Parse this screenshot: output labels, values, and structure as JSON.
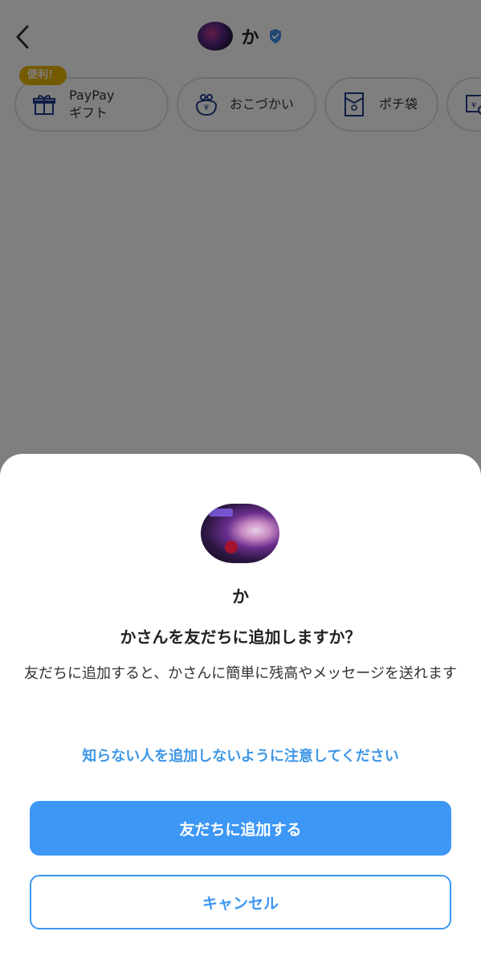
{
  "header": {
    "title": "か",
    "back_icon": "chevron-left-icon",
    "verified_icon": "shield-check-icon"
  },
  "chips": {
    "badge": "便利！",
    "items": [
      {
        "line1": "PayPay",
        "line2": "ギフト",
        "icon": "gift-icon"
      },
      {
        "label": "おこづかい",
        "icon": "coin-purse-icon"
      },
      {
        "label": "ポチ袋",
        "icon": "envelope-icon"
      },
      {
        "icon": "transfer-icon"
      }
    ]
  },
  "dialog": {
    "name": "か",
    "question": "かさんを友だちに追加しますか？",
    "description": "友だちに追加すると、かさんに簡単に残高やメッセージを送れます",
    "caution_link": "知らない人を追加しないように注意してください",
    "primary_button": "友だちに追加する",
    "secondary_button": "キャンセル"
  },
  "colors": {
    "accent": "#3d97f5",
    "link": "#3f97e6",
    "badge": "#e8b400",
    "overlay": "rgba(0,0,0,0.5)"
  }
}
